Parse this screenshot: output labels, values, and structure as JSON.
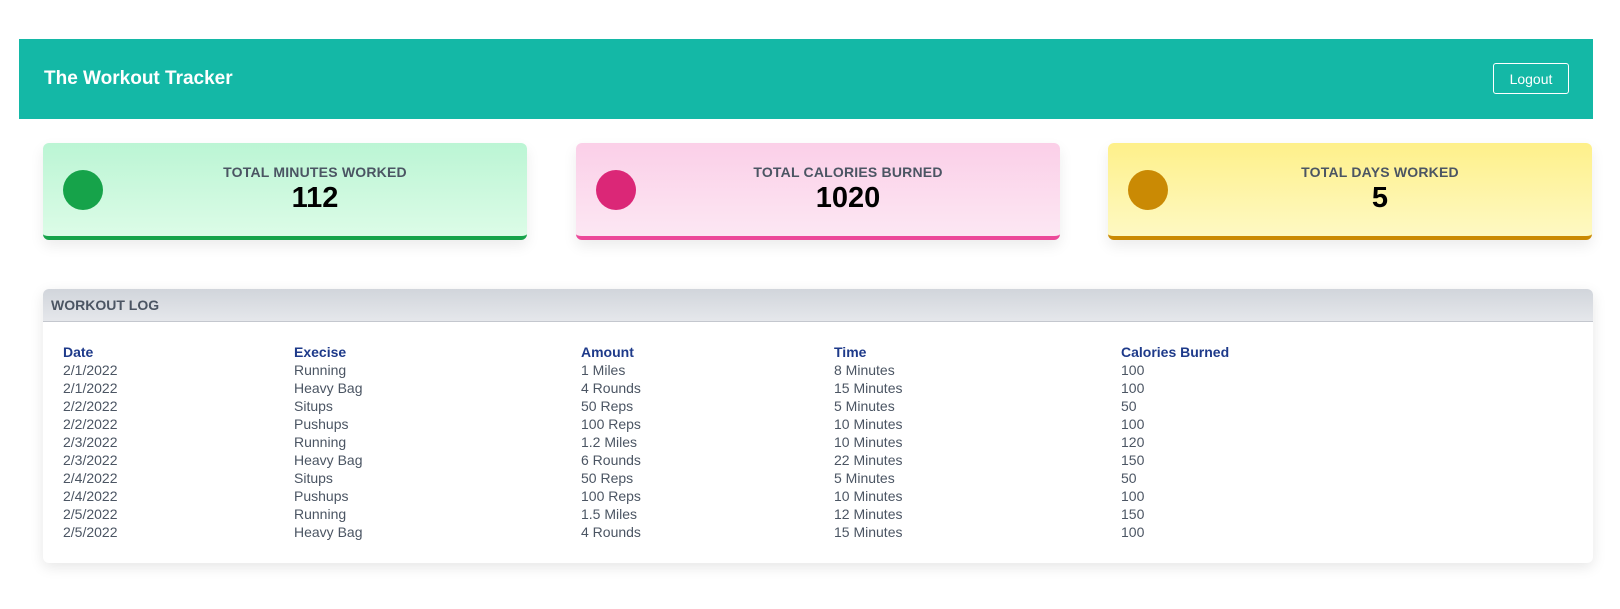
{
  "header": {
    "title": "The Workout Tracker",
    "logout_label": "Logout"
  },
  "stats": [
    {
      "label": "TOTAL MINUTES WORKED",
      "value": "112",
      "color": "#16a34a"
    },
    {
      "label": "TOTAL CALORIES BURNED",
      "value": "1020",
      "color": "#db2777"
    },
    {
      "label": "TOTAL DAYS WORKED",
      "value": "5",
      "color": "#ca8a04"
    }
  ],
  "log": {
    "title": "WORKOUT LOG",
    "columns": [
      "Date",
      "Execise",
      "Amount",
      "Time",
      "Calories Burned"
    ],
    "rows": [
      [
        "2/1/2022",
        "Running",
        "1 Miles",
        "8 Minutes",
        "100"
      ],
      [
        "2/1/2022",
        "Heavy Bag",
        "4 Rounds",
        "15 Minutes",
        "100"
      ],
      [
        "2/2/2022",
        "Situps",
        "50 Reps",
        "5 Minutes",
        "50"
      ],
      [
        "2/2/2022",
        "Pushups",
        "100 Reps",
        "10 Minutes",
        "100"
      ],
      [
        "2/3/2022",
        "Running",
        "1.2 Miles",
        "10 Minutes",
        "120"
      ],
      [
        "2/3/2022",
        "Heavy Bag",
        "6 Rounds",
        "22 Minutes",
        "150"
      ],
      [
        "2/4/2022",
        "Situps",
        "50 Reps",
        "5 Minutes",
        "50"
      ],
      [
        "2/4/2022",
        "Pushups",
        "100 Reps",
        "10 Minutes",
        "100"
      ],
      [
        "2/5/2022",
        "Running",
        "1.5 Miles",
        "12 Minutes",
        "150"
      ],
      [
        "2/5/2022",
        "Heavy Bag",
        "4 Rounds",
        "15 Minutes",
        "100"
      ]
    ]
  },
  "colors": {
    "header_bg": "#14b8a6",
    "column_header_text": "#1e3a8a"
  }
}
